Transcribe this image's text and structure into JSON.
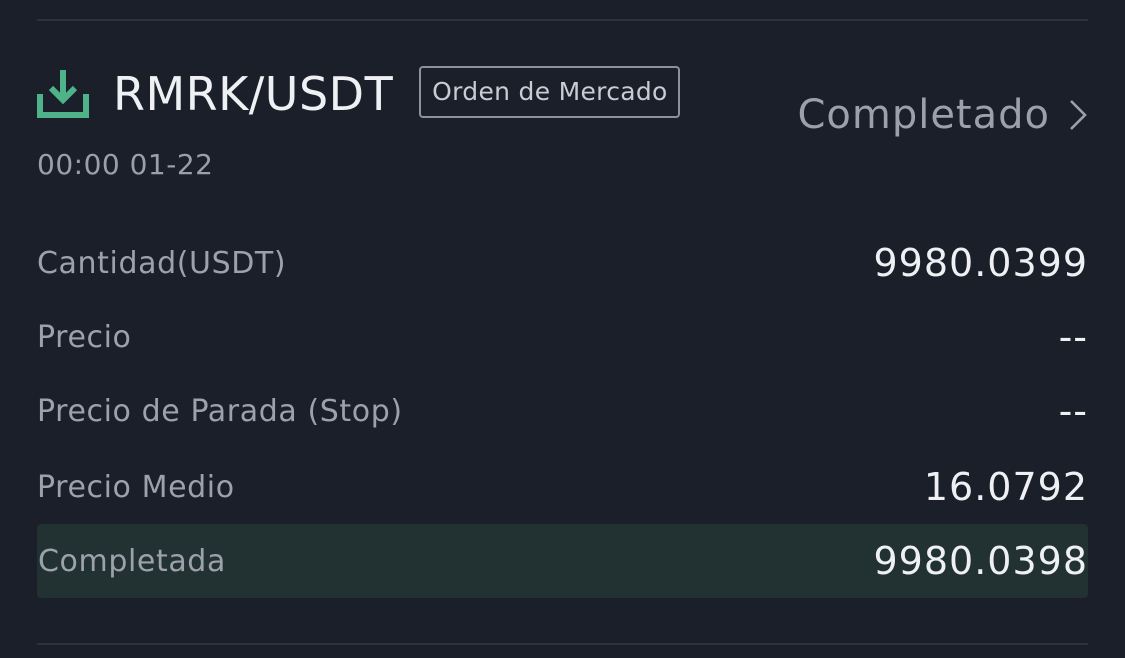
{
  "order": {
    "pair": "RMRK/USDT",
    "type_badge": "Orden de Mercado",
    "status": "Completado",
    "time": "00:00 01-22"
  },
  "details": [
    {
      "label": "Cantidad(USDT)",
      "value": "9980.0399"
    },
    {
      "label": "Precio",
      "value": "--"
    },
    {
      "label": "Precio de Parada (Stop)",
      "value": "--"
    },
    {
      "label": "Precio Medio",
      "value": "16.0792"
    },
    {
      "label": "Completada",
      "value": "9980.0398"
    }
  ],
  "icons": {
    "side": "download-icon",
    "status_arrow": "chevron-right-icon"
  },
  "colors": {
    "background": "#1b1f29",
    "buy_green": "#4fb38a",
    "highlight_row": "#223131"
  }
}
